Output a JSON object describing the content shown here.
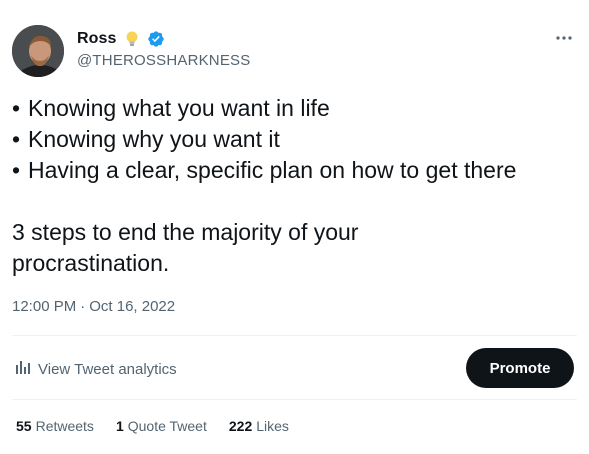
{
  "author": {
    "name": "Ross",
    "handle": "@THEROSSHARKNESS",
    "emoji_icon": "lightbulb-icon",
    "verified_icon": "verified-badge-icon",
    "verified_color": "#1d9bf0"
  },
  "tweet": {
    "bullets": [
      "Knowing what you want in life",
      "Knowing why you want it",
      "Having a clear, specific plan on how to get there"
    ],
    "closing_line_1": "3 steps to end the majority of your",
    "closing_line_2": "procrastination."
  },
  "meta": {
    "time": "12:00 PM",
    "separator": "·",
    "date": "Oct 16, 2022"
  },
  "actions": {
    "analytics_label": "View Tweet analytics",
    "promote_label": "Promote"
  },
  "stats": {
    "retweets": {
      "count": "55",
      "label": "Retweets"
    },
    "quotes": {
      "count": "1",
      "label": "Quote Tweet"
    },
    "likes": {
      "count": "222",
      "label": "Likes"
    }
  },
  "colors": {
    "text_primary": "#0f1419",
    "text_secondary": "#536471",
    "promote_bg": "#0f1419"
  }
}
